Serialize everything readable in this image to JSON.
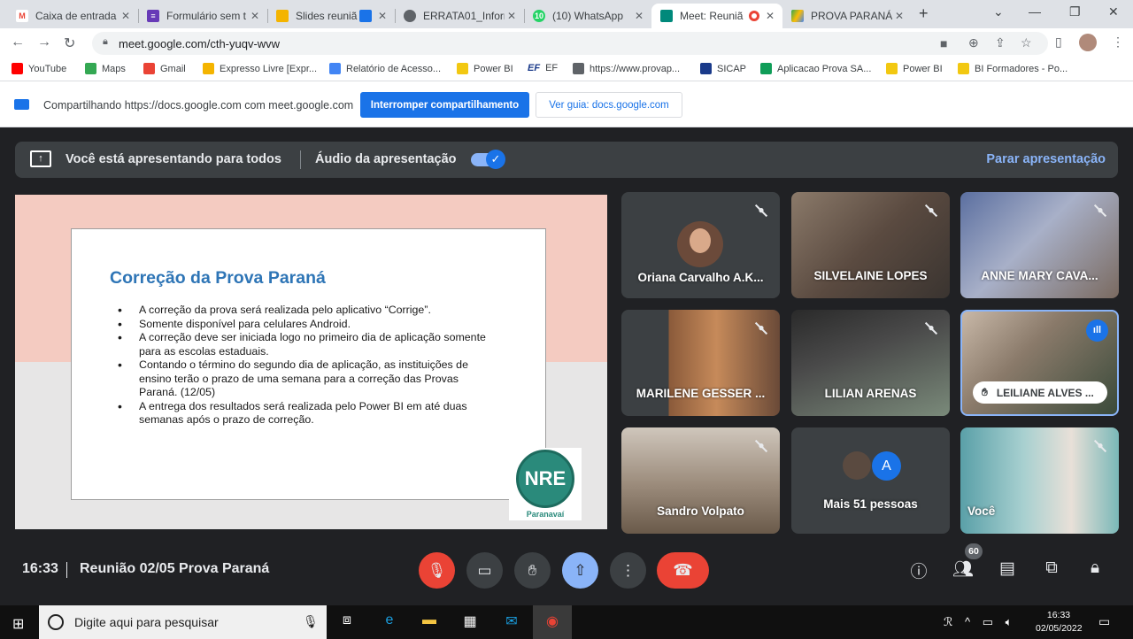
{
  "browser": {
    "tabs": [
      {
        "title": "Caixa de entrada",
        "icon": "gmail-icon",
        "color": "#ea4335"
      },
      {
        "title": "Formulário sem t",
        "icon": "forms-icon",
        "color": "#673ab7"
      },
      {
        "title": "Slides reuniã",
        "icon": "slides-icon",
        "color": "#f4b400"
      },
      {
        "title": "ERRATA01_Inform",
        "icon": "globe-icon",
        "color": "#5f6368"
      },
      {
        "title": "(10) WhatsApp",
        "icon": "whatsapp-icon",
        "color": "#25d366",
        "badge": "10"
      },
      {
        "title": "Meet: Reuniã",
        "icon": "meet-icon",
        "color": "#00897b",
        "active": true
      },
      {
        "title": "PROVA PARANÁ",
        "icon": "drive-icon",
        "color": "#34a853"
      }
    ],
    "url": "meet.google.com/cth-yuqv-wvw",
    "bookmarks": [
      {
        "label": "YouTube",
        "color": "#ff0000"
      },
      {
        "label": "Maps",
        "color": "#34a853"
      },
      {
        "label": "Gmail",
        "color": "#ea4335"
      },
      {
        "label": "Expresso Livre [Expr...",
        "color": "#f4b400"
      },
      {
        "label": "Relatório de Acesso...",
        "color": "#4285f4"
      },
      {
        "label": "Power BI",
        "color": "#f2c811"
      },
      {
        "label": "EF",
        "color": "#1a3a8a",
        "glyph": "EF"
      },
      {
        "label": "https://www.provap...",
        "color": "#5f6368"
      },
      {
        "label": "SICAP",
        "color": "#1a3a8a"
      },
      {
        "label": "Aplicacao Prova SA...",
        "color": "#0f9d58"
      },
      {
        "label": "Power BI",
        "color": "#f2c811"
      },
      {
        "label": "BI Formadores - Po...",
        "color": "#f2c811"
      }
    ]
  },
  "sharebar": {
    "text": "Compartilhando https://docs.google.com com meet.google.com",
    "stop_label": "Interromper compartilhamento",
    "view_label": "Ver guia: docs.google.com"
  },
  "presenting": {
    "text": "Você está apresentando para todos",
    "audio_label": "Áudio da apresentação",
    "audio_on": true,
    "stop_label": "Parar apresentação"
  },
  "slide": {
    "title": "Correção da Prova Paraná",
    "bullets": [
      "A correção da prova será realizada pelo aplicativo “Corrige”.",
      "Somente disponível para celulares Android.",
      "A correção deve ser iniciada logo no primeiro dia de aplicação somente para as escolas estaduais.",
      "Contando o término do segundo dia de aplicação, as instituições de ensino terão o prazo de uma semana para a correção das Provas Paraná. (12/05)",
      " A entrega dos resultados será realizada pelo Power BI em até duas semanas após o prazo de correção."
    ],
    "logo_text": "NRE",
    "logo_sub": "Paranavaí"
  },
  "participants": [
    {
      "name": "Oriana Carvalho A.K...",
      "muted": true
    },
    {
      "name": "SILVELAINE LOPES",
      "muted": true
    },
    {
      "name": "ANNE MARY CAVA...",
      "muted": true
    },
    {
      "name": "MARILENE GESSER ...",
      "muted": true
    },
    {
      "name": "LILIAN ARENAS",
      "muted": true
    },
    {
      "name": "LEILIANE ALVES ...",
      "hand_raised": true,
      "speaking": true
    },
    {
      "name": "Sandro Volpato",
      "muted": true
    },
    {
      "name": "Mais 51 pessoas",
      "avatar_letter": "A"
    },
    {
      "name": "Você",
      "muted": true
    }
  ],
  "meeting": {
    "time": "16:33",
    "title": "Reunião 02/05 Prova Paraná",
    "participant_count": "60"
  },
  "taskbar": {
    "search_placeholder": "Digite aqui para pesquisar",
    "time": "16:33",
    "date": "02/05/2022"
  }
}
